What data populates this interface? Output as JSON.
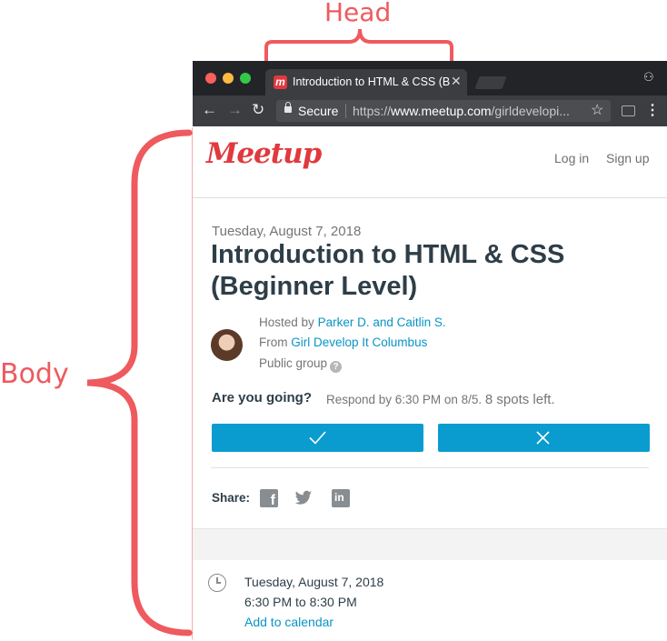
{
  "annotations": {
    "head_label": "Head",
    "body_label": "Body",
    "color": "#ee5a5e"
  },
  "browser": {
    "tab_title": "Introduction to HTML & CSS (B",
    "secure_label": "Secure",
    "url_prefix": "https://",
    "url_domain": "www.meetup.com",
    "url_path": "/girldevelopi...",
    "icons": [
      "back-arrow-icon",
      "forward-arrow-icon",
      "reload-icon",
      "lock-icon",
      "star-icon",
      "cast-icon",
      "menu-icon",
      "incognito-icon",
      "close-icon"
    ]
  },
  "page": {
    "logo": "Meetup",
    "login": "Log in",
    "signup": "Sign up",
    "date": "Tuesday, August 7, 2018",
    "title": "Introduction to HTML & CSS (Beginner Level)",
    "hosted_by_label": "Hosted by",
    "hosts": "Parker D. and Caitlin S.",
    "from_label": "From",
    "group": "Girl Develop It Columbus",
    "group_type": "Public group",
    "help_glyph": "?",
    "going_question": "Are you going?",
    "respond_text": "Respond by 6:30 PM on 8/5.",
    "spots_text": "8 spots left.",
    "share_label": "Share:",
    "detail_date": "Tuesday, August 7, 2018",
    "detail_time": "6:30 PM to 8:30 PM",
    "add_calendar": "Add to calendar",
    "brand_color": "#e0393e",
    "button_color": "#0a9ccf",
    "link_color": "#0a94c4"
  }
}
